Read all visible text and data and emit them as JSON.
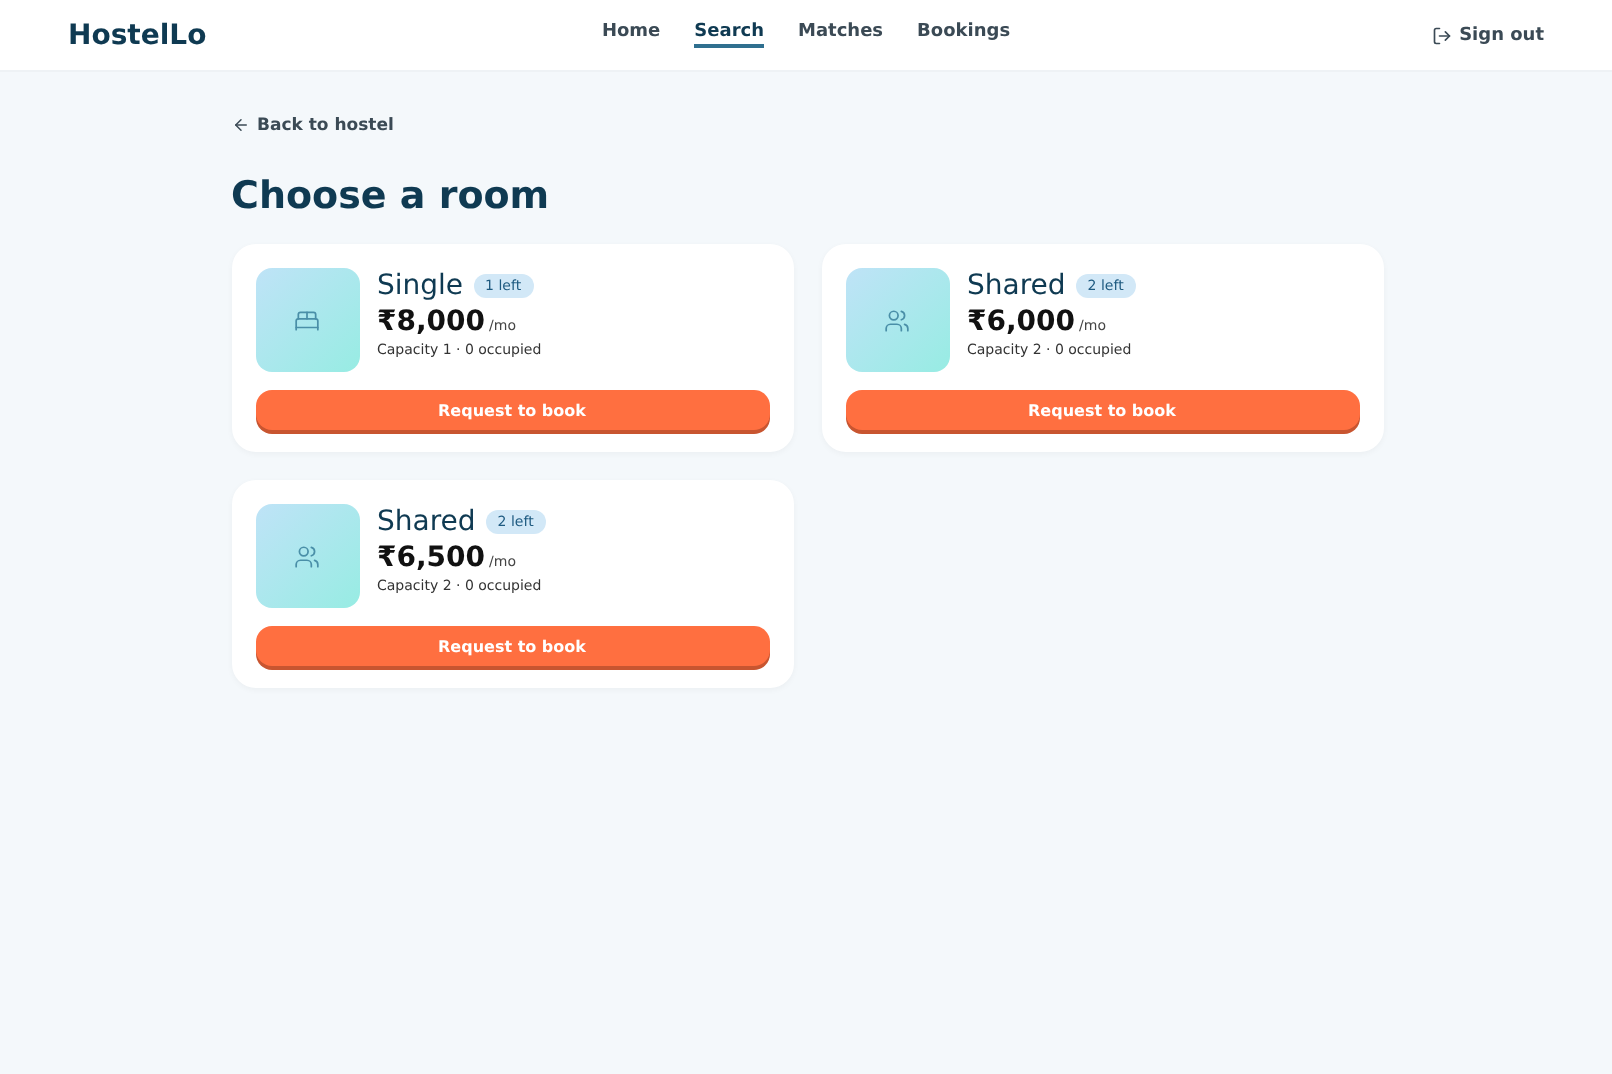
{
  "brand": "HostelLo",
  "nav": [
    {
      "label": "Home",
      "selected": false
    },
    {
      "label": "Search",
      "selected": true
    },
    {
      "label": "Matches",
      "selected": false
    },
    {
      "label": "Bookings",
      "selected": false
    }
  ],
  "sign_out": "Sign out",
  "back_link": "Back to hostel",
  "title": "Choose a room",
  "rooms": [
    {
      "kind": "single",
      "name": "Single",
      "badge": "1 left",
      "price": "₹8,000",
      "unit": "/mo",
      "details": "Capacity 1 · 0 occupied",
      "button": "Request to book"
    },
    {
      "kind": "shared",
      "name": "Shared",
      "badge": "2 left",
      "price": "₹6,000",
      "unit": "/mo",
      "details": "Capacity 2 · 0 occupied",
      "button": "Request to book"
    },
    {
      "kind": "shared",
      "name": "Shared",
      "badge": "2 left",
      "price": "₹6,500",
      "unit": "/mo",
      "details": "Capacity 2 · 0 occupied",
      "button": "Request to book"
    }
  ]
}
